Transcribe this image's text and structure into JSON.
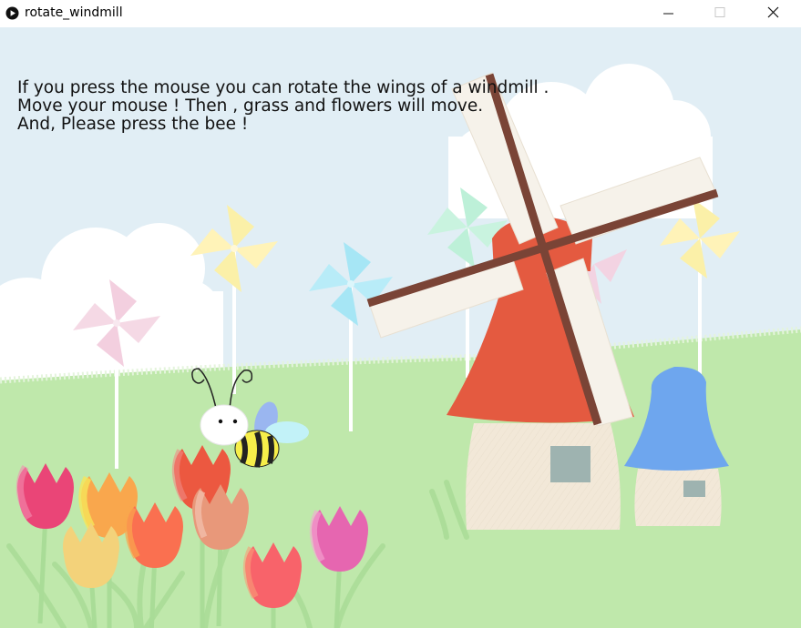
{
  "window": {
    "title": "rotate_windmill",
    "icons": {
      "app": "play-circle-icon",
      "minimize": "minimize-icon",
      "maximize": "maximize-icon",
      "close": "close-icon"
    }
  },
  "sketch": {
    "instructions": [
      "If you press the mouse you can rotate the wings of a windmill .",
      "Move your mouse ! Then , grass and flowers will move.",
      "And, Please press the bee !"
    ],
    "colors": {
      "sky": "#e1eef5",
      "cloud": "#ffffff",
      "grass": "#bfe8ab",
      "windmill_roof": "#e45a40",
      "windmill_body": "#f2e8d8",
      "windmill_blade": "#f6f2ea",
      "windmill_frame": "#7a4436",
      "small_roof": "#6ea6ee",
      "window": "#9eb3b0"
    },
    "objects": {
      "bee": "bee-icon",
      "windmill": "windmill",
      "small_house": "small-house",
      "pinwheels": [
        "pinwheel-pink",
        "pinwheel-yellow",
        "pinwheel-cyan",
        "pinwheel-mint",
        "pinwheel-yellow-right"
      ],
      "tulips": [
        "tulip",
        "tulip",
        "tulip",
        "tulip",
        "tulip",
        "tulip",
        "tulip",
        "tulip",
        "tulip"
      ]
    }
  }
}
